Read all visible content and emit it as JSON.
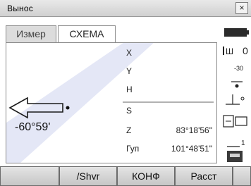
{
  "window": {
    "title": "Вынос",
    "close_label": "×"
  },
  "tabs": [
    {
      "label": "Измер",
      "active": false
    },
    {
      "label": "СХЕМА",
      "active": true
    }
  ],
  "diagram": {
    "angle_label": "-60°59'",
    "fields": [
      {
        "name": "X",
        "value": ""
      },
      {
        "name": "Y",
        "value": ""
      },
      {
        "name": "H",
        "value": ""
      },
      {
        "name": "S",
        "value": ""
      },
      {
        "name": "Z",
        "value": "83°18'56\""
      },
      {
        "name": "Гуп",
        "value": "101°48'51\""
      }
    ]
  },
  "side": {
    "battery_label": "",
    "prism_label": "0",
    "prism_letter": "Ш",
    "prism_const": "-30",
    "fine_label": "1"
  },
  "softkeys": [
    {
      "label": ""
    },
    {
      "label": "/Shvr"
    },
    {
      "label": "КОНФ"
    },
    {
      "label": "Расст"
    },
    {
      "label": ""
    }
  ],
  "colors": {
    "accent": "#1f3bb5",
    "panel_border": "#8b8b8b",
    "titlebar": "#d8d8d8"
  }
}
